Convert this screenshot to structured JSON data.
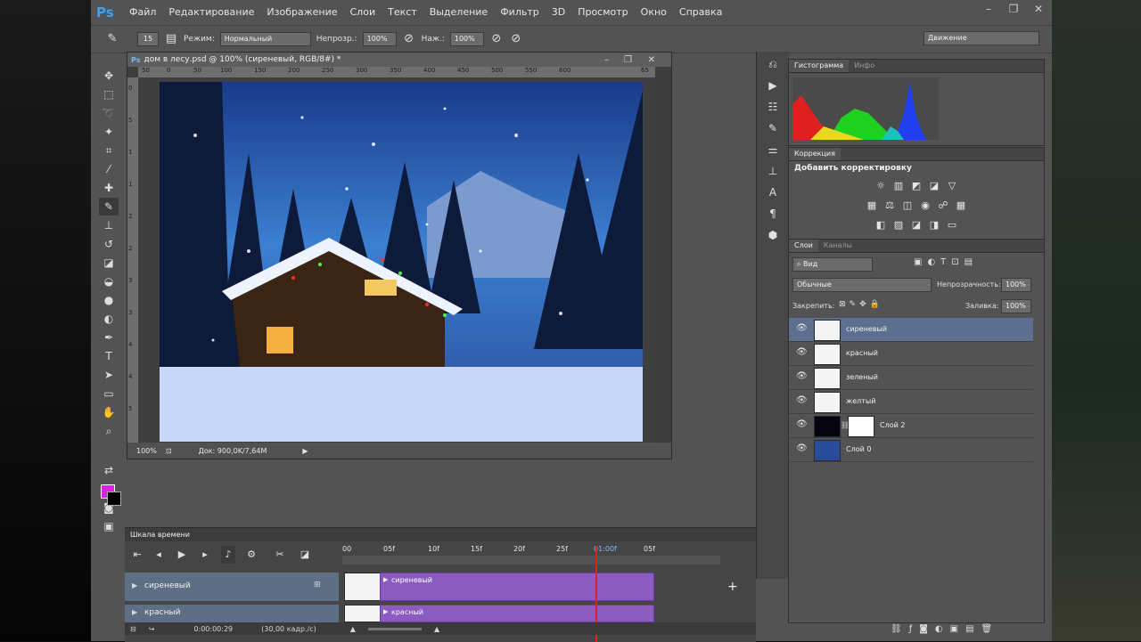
{
  "app": {
    "logo": "Ps"
  },
  "menu": [
    "Файл",
    "Редактирование",
    "Изображение",
    "Слои",
    "Текст",
    "Выделение",
    "Фильтр",
    "3D",
    "Просмотр",
    "Окно",
    "Справка"
  ],
  "window_controls": [
    "–",
    "❐",
    "✕"
  ],
  "options": {
    "brush_size": "15",
    "mode_label": "Режим:",
    "mode_value": "Нормальный",
    "opacity_label": "Непрозр.:",
    "opacity_value": "100%",
    "pressure_label": "Наж.:",
    "pressure_value": "100%",
    "workspace": "Движение"
  },
  "document": {
    "title": "дом в лесу.psd @ 100% (сиреневый, RGB/8#) *",
    "zoom": "100%",
    "doc_size": "Док: 900,0K/7,64M",
    "ruler_h": [
      "50",
      "0",
      "50",
      "100",
      "150",
      "200",
      "250",
      "300",
      "350",
      "400",
      "450",
      "500",
      "550",
      "600",
      "65"
    ],
    "ruler_v": [
      "0",
      "5",
      "1",
      "1",
      "2",
      "2",
      "3",
      "3",
      "4",
      "4",
      "5"
    ]
  },
  "panels": {
    "histogram_tab": "Гистограмма",
    "info_tab": "Инфо",
    "correction_tab": "Коррекция",
    "correction_title": "Добавить корректировку",
    "layers_tab": "Слои",
    "channels_tab": "Каналы",
    "layers_filter": "Вид",
    "blend_mode": "Обычные",
    "opacity_label": "Непрозрачность:",
    "opacity_value": "100%",
    "lock_label": "Закрепить:",
    "fill_label": "Заливка:",
    "fill_value": "100%"
  },
  "layers": [
    {
      "name": "сиреневый",
      "selected": true
    },
    {
      "name": "красный",
      "selected": false
    },
    {
      "name": "зеленый",
      "selected": false
    },
    {
      "name": "желтый",
      "selected": false
    },
    {
      "name": "Слой 2",
      "selected": false
    },
    {
      "name": "Слой 0",
      "selected": false
    }
  ],
  "timeline": {
    "title": "Шкала времени",
    "ticks": [
      "00",
      "05f",
      "10f",
      "15f",
      "20f",
      "25f",
      "01:00f",
      "05f"
    ],
    "time": "0:00:00:29",
    "fps": "(30,00 кадр./с)",
    "tracks": [
      {
        "name": "сиреневый",
        "clip": "сиреневый"
      },
      {
        "name": "красный",
        "clip": "красный"
      }
    ]
  },
  "colors": {
    "accent": "#3ea0f0",
    "foreground": "#e020e0",
    "background": "#000000",
    "clip": "#8a5cc0",
    "selection": "#5c6f8f"
  }
}
